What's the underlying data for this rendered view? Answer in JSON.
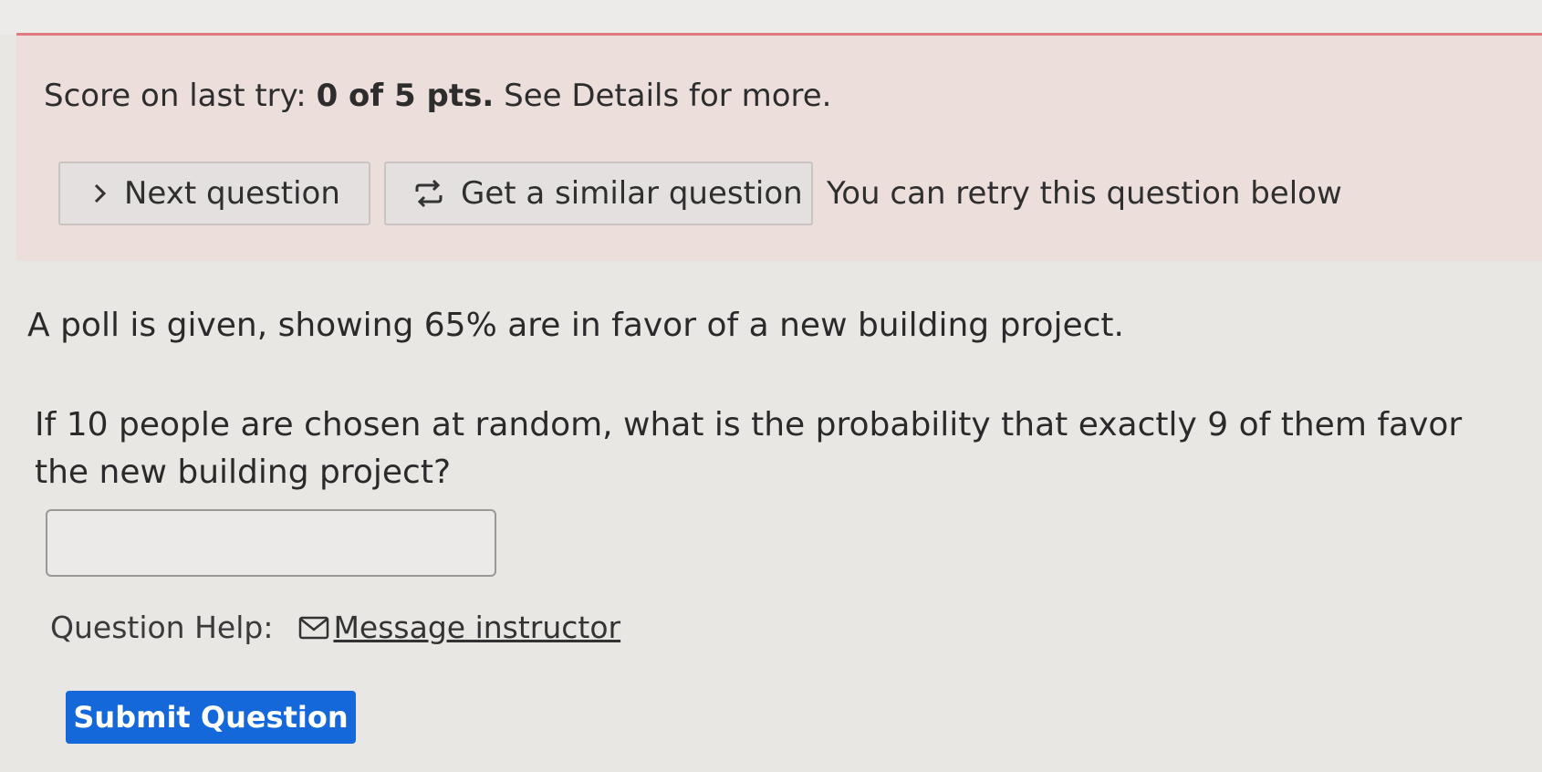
{
  "score": {
    "prefix": "Score on last try:",
    "value": "0 of 5 pts.",
    "suffix": "See Details for more."
  },
  "actions": {
    "next_label": "Next question",
    "similar_label": "Get a similar question",
    "retry_text": "You can retry this question below"
  },
  "question": {
    "paragraph1": "A poll is given, showing 65% are in favor of a new building project.",
    "paragraph2": "If 10 people are chosen at random, what is the probability that exactly 9 of them favor the new building project?"
  },
  "answer": {
    "value": ""
  },
  "help": {
    "label": "Question Help:",
    "message_link": "Message instructor"
  },
  "submit_label": "Submit Question",
  "icons": {
    "next": "chevron-right-icon",
    "similar": "repeat-icon",
    "message": "envelope-icon"
  }
}
